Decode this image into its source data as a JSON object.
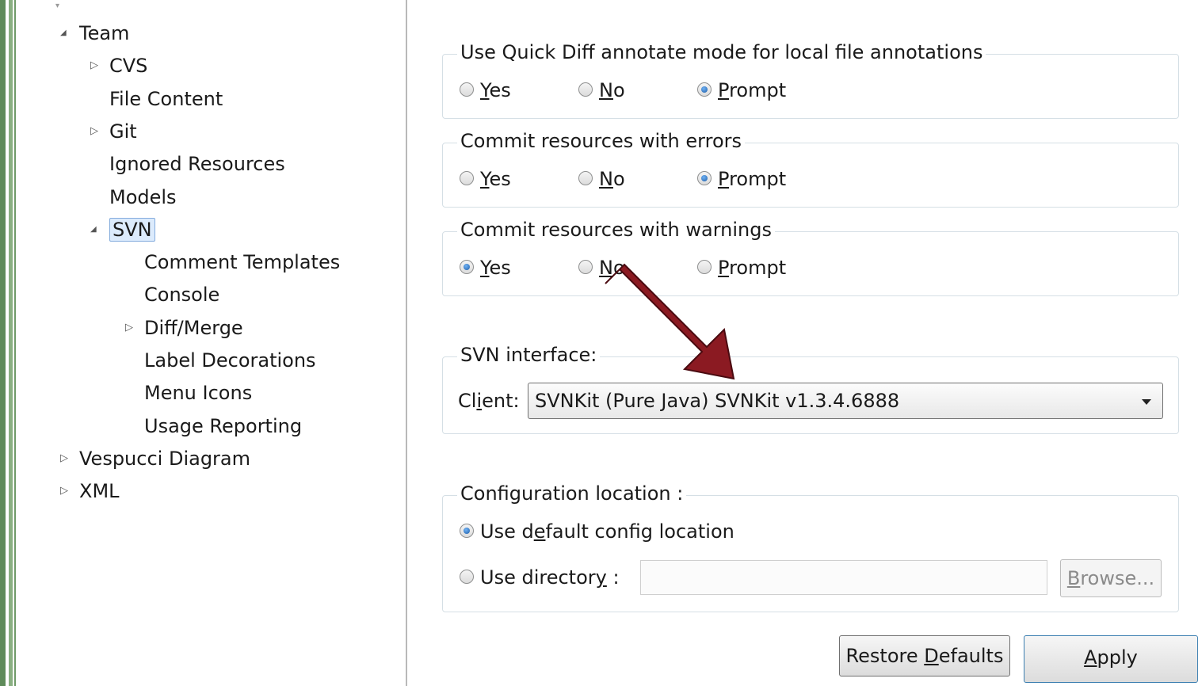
{
  "tree": {
    "items": [
      {
        "label": "Team",
        "indent": 0,
        "twisty": "expanded"
      },
      {
        "label": "CVS",
        "indent": 1,
        "twisty": "collapsed"
      },
      {
        "label": "File Content",
        "indent": 1,
        "twisty": "none"
      },
      {
        "label": "Git",
        "indent": 1,
        "twisty": "collapsed"
      },
      {
        "label": "Ignored Resources",
        "indent": 1,
        "twisty": "none"
      },
      {
        "label": "Models",
        "indent": 1,
        "twisty": "none"
      },
      {
        "label": "SVN",
        "indent": 1,
        "twisty": "expanded",
        "selected": true
      },
      {
        "label": "Comment Templates",
        "indent": 2,
        "twisty": "none"
      },
      {
        "label": "Console",
        "indent": 2,
        "twisty": "none"
      },
      {
        "label": "Diff/Merge",
        "indent": 2,
        "twisty": "collapsed"
      },
      {
        "label": "Label Decorations",
        "indent": 2,
        "twisty": "none"
      },
      {
        "label": "Menu Icons",
        "indent": 2,
        "twisty": "none"
      },
      {
        "label": "Usage Reporting",
        "indent": 2,
        "twisty": "none"
      },
      {
        "label": "Vespucci Diagram",
        "indent": 0,
        "twisty": "collapsed"
      },
      {
        "label": "XML",
        "indent": 0,
        "twisty": "collapsed"
      }
    ]
  },
  "groups": {
    "quick_diff": {
      "title": "Use Quick Diff annotate mode for local file annotations",
      "selected": "prompt"
    },
    "commit_errors": {
      "title": "Commit resources with errors",
      "selected": "prompt"
    },
    "commit_warnings": {
      "title": "Commit resources with warnings",
      "selected": "yes"
    }
  },
  "radio_labels": {
    "yes": {
      "mnemonic": "Y",
      "rest": "es"
    },
    "no": {
      "mnemonic": "N",
      "rest": "o"
    },
    "prompt": {
      "mnemonic": "P",
      "rest": "rompt"
    }
  },
  "svn_interface": {
    "title": "SVN interface:",
    "client_label_pre": "Cl",
    "client_label_mnemonic": "i",
    "client_label_post": "ent:",
    "client_value": "SVNKit (Pure Java) SVNKit v1.3.4.6888"
  },
  "config_location": {
    "title": "Configuration location :",
    "default_pre": "Use d",
    "default_mnemonic": "e",
    "default_post": "fault config location",
    "directory_pre": "Use director",
    "directory_mnemonic": "y",
    "directory_post": " :",
    "directory_value": "",
    "browse_mnemonic": "B",
    "browse_rest": "rowse..."
  },
  "buttons": {
    "restore_pre": "Restore ",
    "restore_mnemonic": "D",
    "restore_post": "efaults",
    "apply_mnemonic": "A",
    "apply_rest": "pply"
  },
  "colors": {
    "arrow": "#8b1a22",
    "selection": "#dcebfc",
    "green_bar": "#5f8b5a"
  }
}
